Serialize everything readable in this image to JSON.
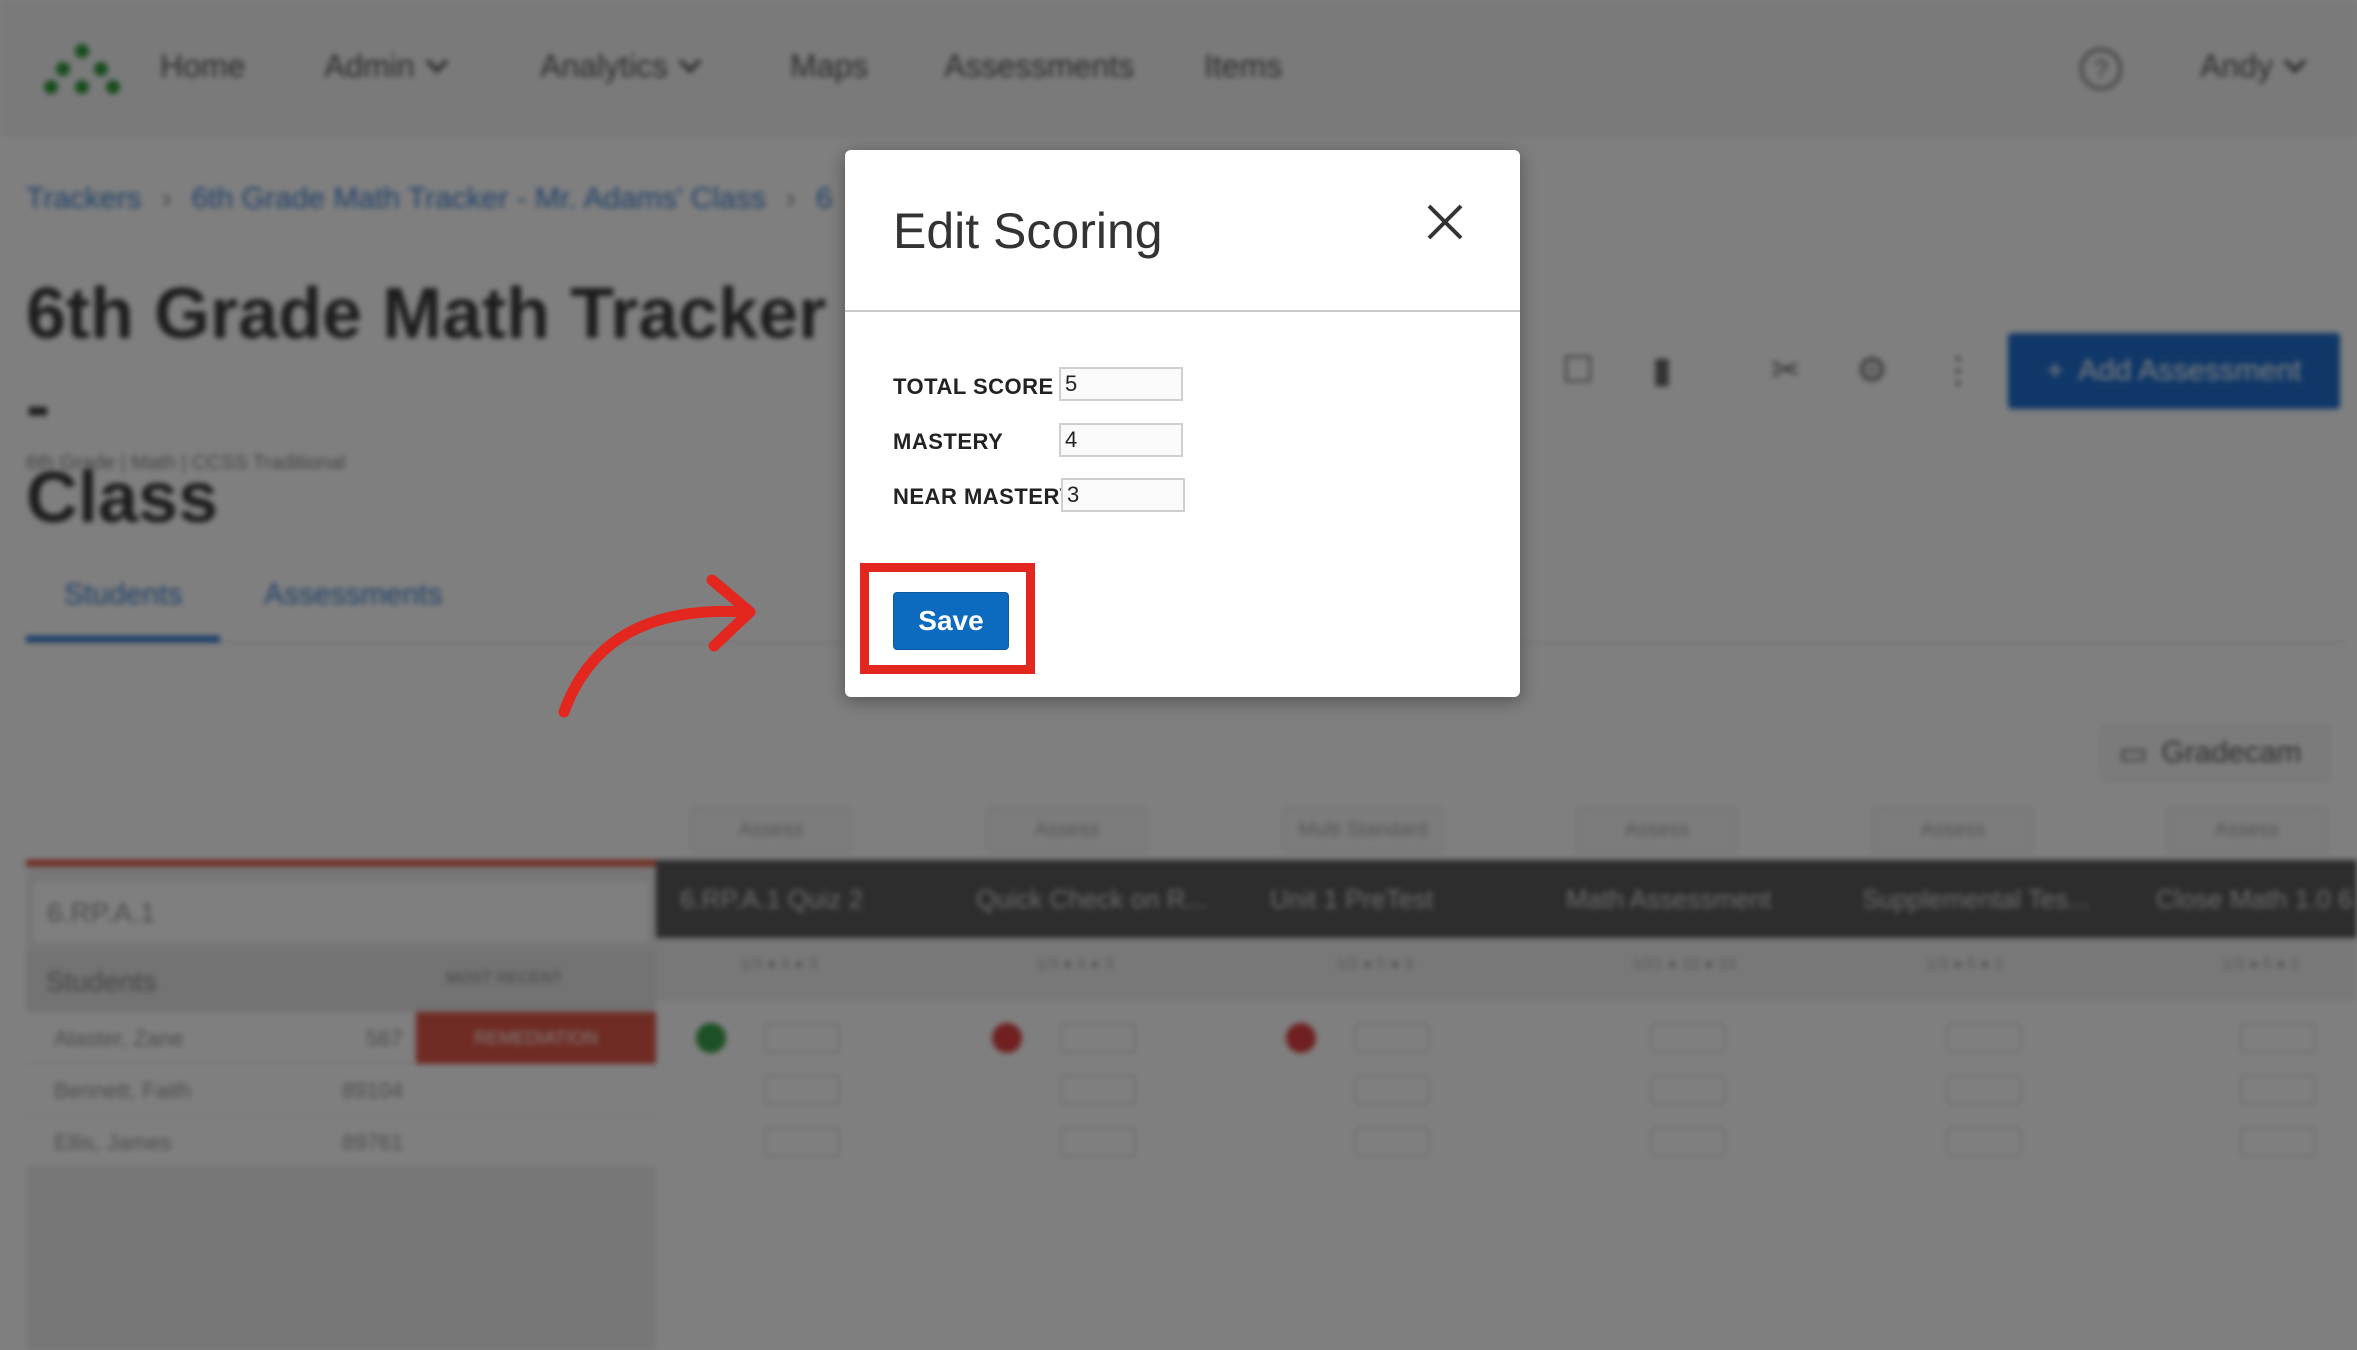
{
  "nav": {
    "items": [
      {
        "label": "Home",
        "dropdown": false
      },
      {
        "label": "Admin",
        "dropdown": true
      },
      {
        "label": "Analytics",
        "dropdown": true
      },
      {
        "label": "Maps",
        "dropdown": false
      },
      {
        "label": "Assessments",
        "dropdown": false
      },
      {
        "label": "Items",
        "dropdown": false
      }
    ],
    "help_icon": "question-circle-icon",
    "user": "Andy"
  },
  "breadcrumb": [
    "Trackers",
    "6th Grade Math Tracker - Mr. Adams' Class",
    "6"
  ],
  "page": {
    "title_line1": "6th Grade Math Tracker -",
    "title_line2": "Class",
    "subtitle": "6th Grade | Math | CCSS Traditional",
    "add_button": "Add Assessment",
    "tabs": [
      "Students",
      "Assessments"
    ],
    "gradecam": "Gradecam"
  },
  "grid": {
    "standard": "6.RP.A.1",
    "students_header": "Students",
    "sort_label": "MOST RECENT",
    "students": [
      {
        "name": "Alaster, Zane",
        "id": "567",
        "status": "REMEDIATION"
      },
      {
        "name": "Bennett, Faith",
        "id": "89104",
        "status": ""
      },
      {
        "name": "Ellis, James",
        "id": "89761",
        "status": ""
      }
    ],
    "assess_tag": "Assess",
    "columns": [
      {
        "tag": "Assess",
        "title": "6.RP.A.1 Quiz 2",
        "sub": "1/3 ● 4 ● 3"
      },
      {
        "tag": "Assess",
        "title": "Quick Check on R...",
        "sub": "1/3 ● 4 ● 3"
      },
      {
        "tag": "Multi Standard",
        "title": "Unit 1 PreTest",
        "sub": "1/2 ● 5 ● 3"
      },
      {
        "tag": "Assess",
        "title": "Math Assessment",
        "sub": "1/21 ● 10 ● 10"
      },
      {
        "tag": "Assess",
        "title": "Supplemental Tes...",
        "sub": "1/3 ● 5 ● 2"
      },
      {
        "tag": "Assess",
        "title": "Close Math 1.0 6",
        "sub": "1/3 ● 5 ● 2"
      }
    ]
  },
  "modal": {
    "title": "Edit Scoring",
    "fields": [
      {
        "label": "TOTAL SCORE",
        "value": "5"
      },
      {
        "label": "MASTERY",
        "value": "4"
      },
      {
        "label": "NEAR MASTERY",
        "value": "3"
      }
    ],
    "save_label": "Save"
  },
  "annotation": {
    "highlight_color": "#e3271e"
  },
  "colors": {
    "brand_green": "#2e9a3c",
    "primary_blue": "#0c6bbf",
    "remediation_red": "#e05848"
  }
}
